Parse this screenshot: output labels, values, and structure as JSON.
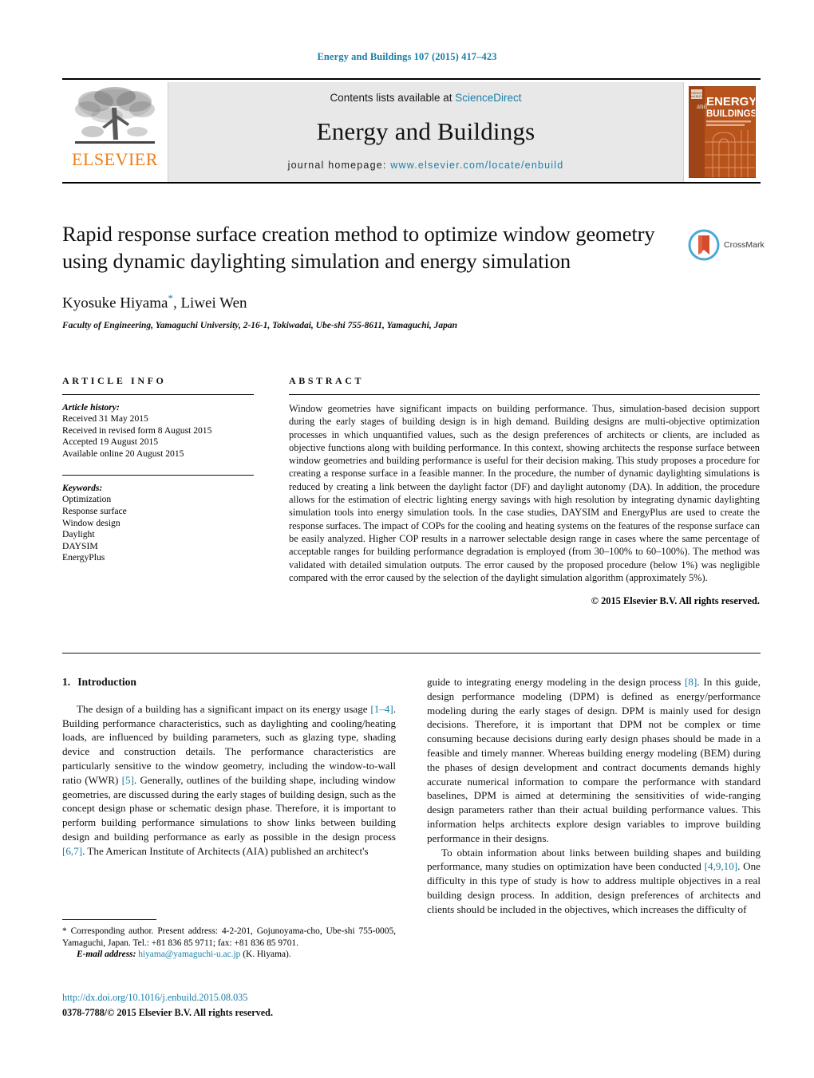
{
  "running_head": "Energy and Buildings 107 (2015) 417–423",
  "masthead": {
    "contents_prefix": "Contents lists available at ",
    "contents_link": "ScienceDirect",
    "journal_name": "Energy and Buildings",
    "homepage_prefix": "journal homepage:",
    "homepage_link": "www.elsevier.com/locate/enbuild",
    "publisher_wordmark": "ELSEVIER",
    "cover_title_line1": "ENERGY",
    "cover_title_line2": "BUILDINGS",
    "cover_and": "and"
  },
  "article": {
    "title": "Rapid response surface creation method to optimize window geometry using dynamic daylighting simulation and energy simulation",
    "authors": "Kyosuke Hiyama, Liwei Wen",
    "author_marker": "*",
    "affiliation": "Faculty of Engineering, Yamaguchi University, 2-16-1, Tokiwadai, Ube-shi 755-8611, Yamaguchi, Japan",
    "crossmark_label": "CrossMark"
  },
  "article_info": {
    "heading": "ARTICLE INFO",
    "history_label": "Article history:",
    "history": [
      "Received 31 May 2015",
      "Received in revised form 8 August 2015",
      "Accepted 19 August 2015",
      "Available online 20 August 2015"
    ],
    "keywords_label": "Keywords:",
    "keywords": [
      "Optimization",
      "Response surface",
      "Window design",
      "Daylight",
      "DAYSIM",
      "EnergyPlus"
    ]
  },
  "abstract": {
    "heading": "ABSTRACT",
    "text": "Window geometries have significant impacts on building performance. Thus, simulation-based decision support during the early stages of building design is in high demand. Building designs are multi-objective optimization processes in which unquantified values, such as the design preferences of architects or clients, are included as objective functions along with building performance. In this context, showing architects the response surface between window geometries and building performance is useful for their decision making. This study proposes a procedure for creating a response surface in a feasible manner. In the procedure, the number of dynamic daylighting simulations is reduced by creating a link between the daylight factor (DF) and daylight autonomy (DA). In addition, the procedure allows for the estimation of electric lighting energy savings with high resolution by integrating dynamic daylighting simulation tools into energy simulation tools. In the case studies, DAYSIM and EnergyPlus are used to create the response surfaces. The impact of COPs for the cooling and heating systems on the features of the response surface can be easily analyzed. Higher COP results in a narrower selectable design range in cases where the same percentage of acceptable ranges for building performance degradation is employed (from 30–100% to 60–100%). The method was validated with detailed simulation outputs. The error caused by the proposed procedure (below 1%) was negligible compared with the error caused by the selection of the daylight simulation algorithm (approximately 5%).",
    "copyright": "© 2015 Elsevier B.V. All rights reserved."
  },
  "body": {
    "section_number": "1.",
    "section_title": "Introduction",
    "left_paragraph_1_a": "The design of a building has a significant impact on its energy usage ",
    "left_cite_1": "[1–4]",
    "left_paragraph_1_b": ". Building performance characteristics, such as daylighting and cooling/heating loads, are influenced by building parameters, such as glazing type, shading device and construction details. The performance characteristics are particularly sensitive to the window geometry, including the window-to-wall ratio (WWR) ",
    "left_cite_2": "[5]",
    "left_paragraph_1_c": ". Generally, outlines of the building shape, including window geometries, are discussed during the early stages of building design, such as the concept design phase or schematic design phase. Therefore, it is important to perform building performance simulations to show links between building design and building performance as early as possible in the design process ",
    "left_cite_3": "[6,7]",
    "left_paragraph_1_d": ". The American Institute of Architects (AIA) published an architect's",
    "right_paragraph_1_a": "guide to integrating energy modeling in the design process ",
    "right_cite_1": "[8]",
    "right_paragraph_1_b": ". In this guide, design performance modeling (DPM) is defined as energy/performance modeling during the early stages of design. DPM is mainly used for design decisions. Therefore, it is important that DPM not be complex or time consuming because decisions during early design phases should be made in a feasible and timely manner. Whereas building energy modeling (BEM) during the phases of design development and contract documents demands highly accurate numerical information to compare the performance with standard baselines, DPM is aimed at determining the sensitivities of wide-ranging design parameters rather than their actual building performance values. This information helps architects explore design variables to improve building performance in their designs.",
    "right_paragraph_2_a": "To obtain information about links between building shapes and building performance, many studies on optimization have been conducted ",
    "right_cite_2": "[4,9,10]",
    "right_paragraph_2_b": ". One difficulty in this type of study is how to address multiple objectives in a real building design process. In addition, design preferences of architects and clients should be included in the objectives, which increases the difficulty of"
  },
  "footnote": {
    "marker": "*",
    "text_a": " Corresponding author. Present address: 4-2-201, Gojunoyama-cho, Ube-shi 755-0005, Yamaguchi, Japan. Tel.: +81 836 85 9711; fax: +81 836 85 9701.",
    "email_label": "E-mail address:",
    "email": "hiyama@yamaguchi-u.ac.jp",
    "email_suffix": " (K. Hiyama)."
  },
  "footer": {
    "doi": "http://dx.doi.org/10.1016/j.enbuild.2015.08.035",
    "issn": "0378-7788/© 2015 Elsevier B.V. All rights reserved."
  },
  "colors": {
    "link": "#1a7fa8",
    "elsevier_orange": "#ef7d1a",
    "cover_orange": "#c2561c"
  }
}
